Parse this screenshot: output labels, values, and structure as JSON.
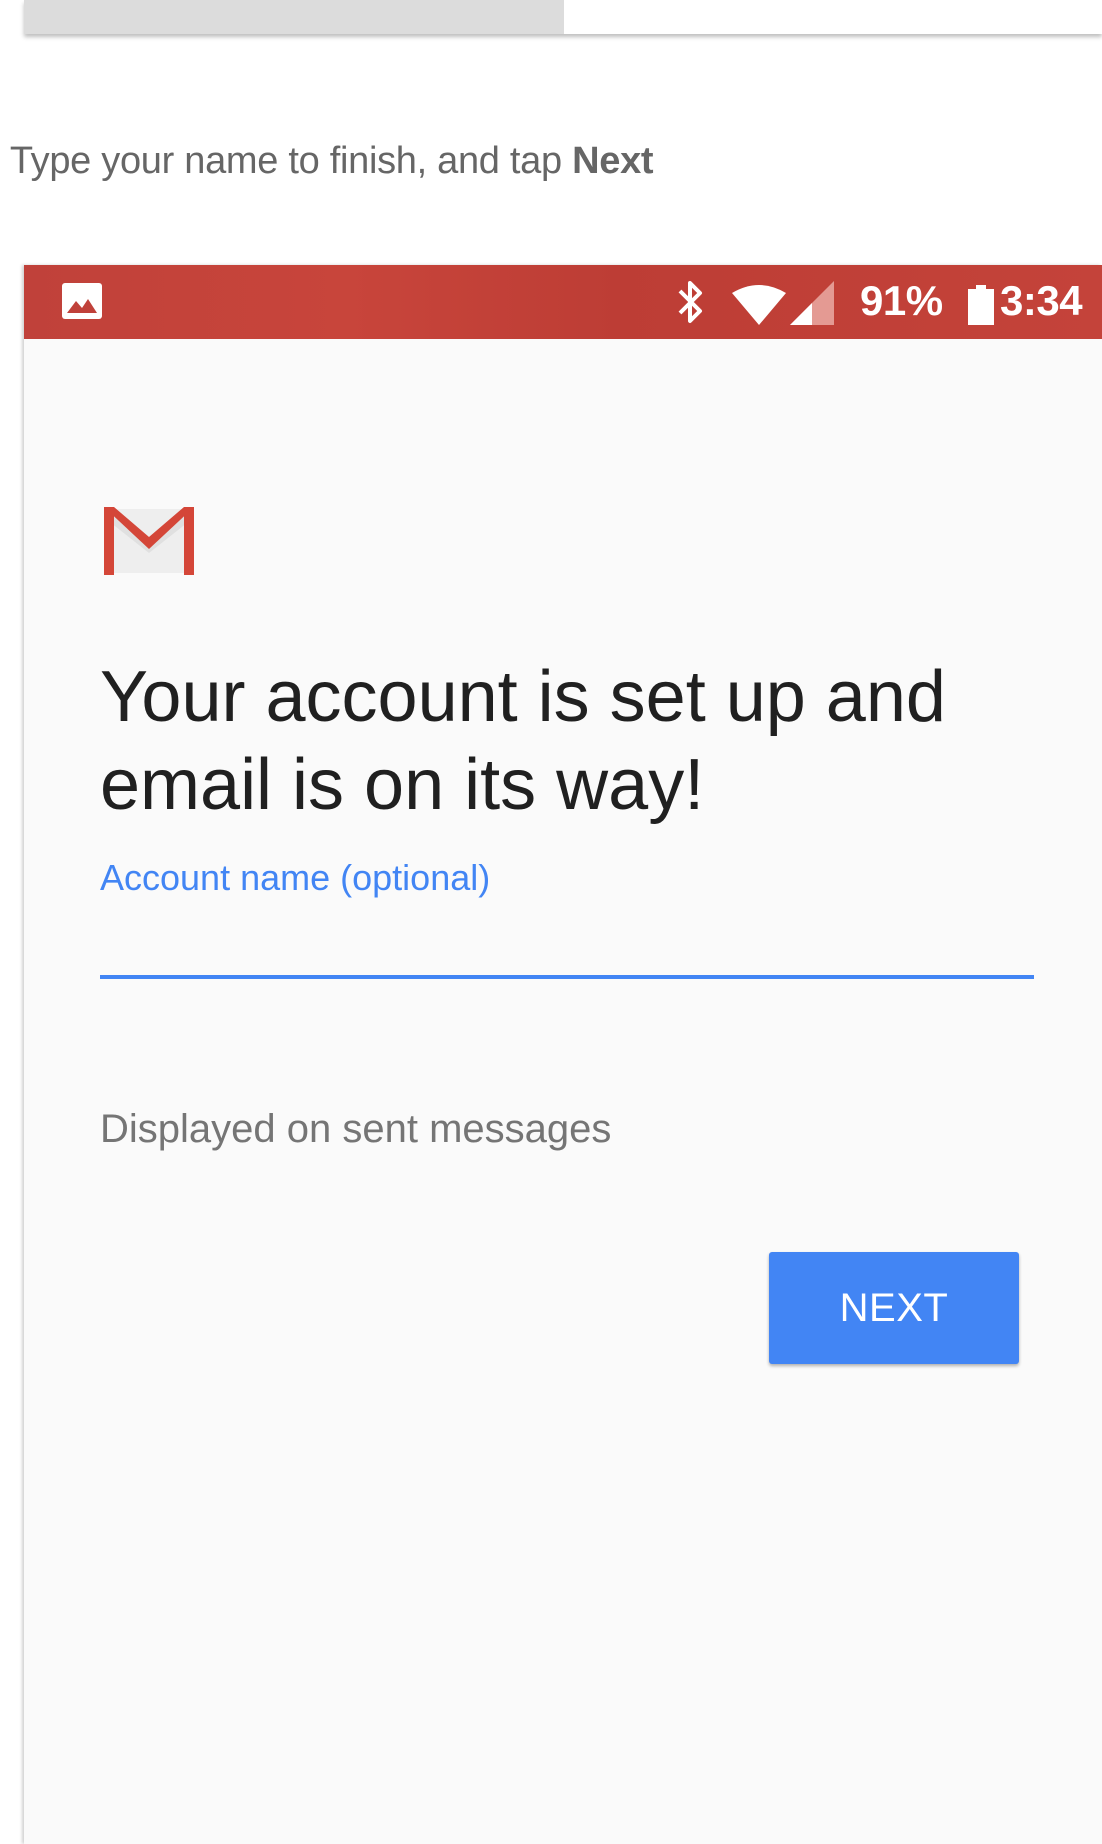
{
  "instruction": {
    "prefix": ". Type your name to finish, and tap ",
    "emphasis": "Next"
  },
  "status_bar": {
    "background": "#c0413a",
    "icons": [
      "gallery-icon",
      "bluetooth-icon",
      "wifi-icon",
      "signal-icon",
      "battery-icon"
    ],
    "battery": "91%",
    "time": "3:34"
  },
  "setup": {
    "logo": "gmail-logo",
    "headline": "Your account is set up and email is on its way!",
    "field_label": "Account name (optional)",
    "field_value": "",
    "helper_text": "Displayed on sent messages",
    "next_label": "NEXT"
  },
  "colors": {
    "accent": "#4285f4",
    "gmail_red": "#d44638"
  }
}
